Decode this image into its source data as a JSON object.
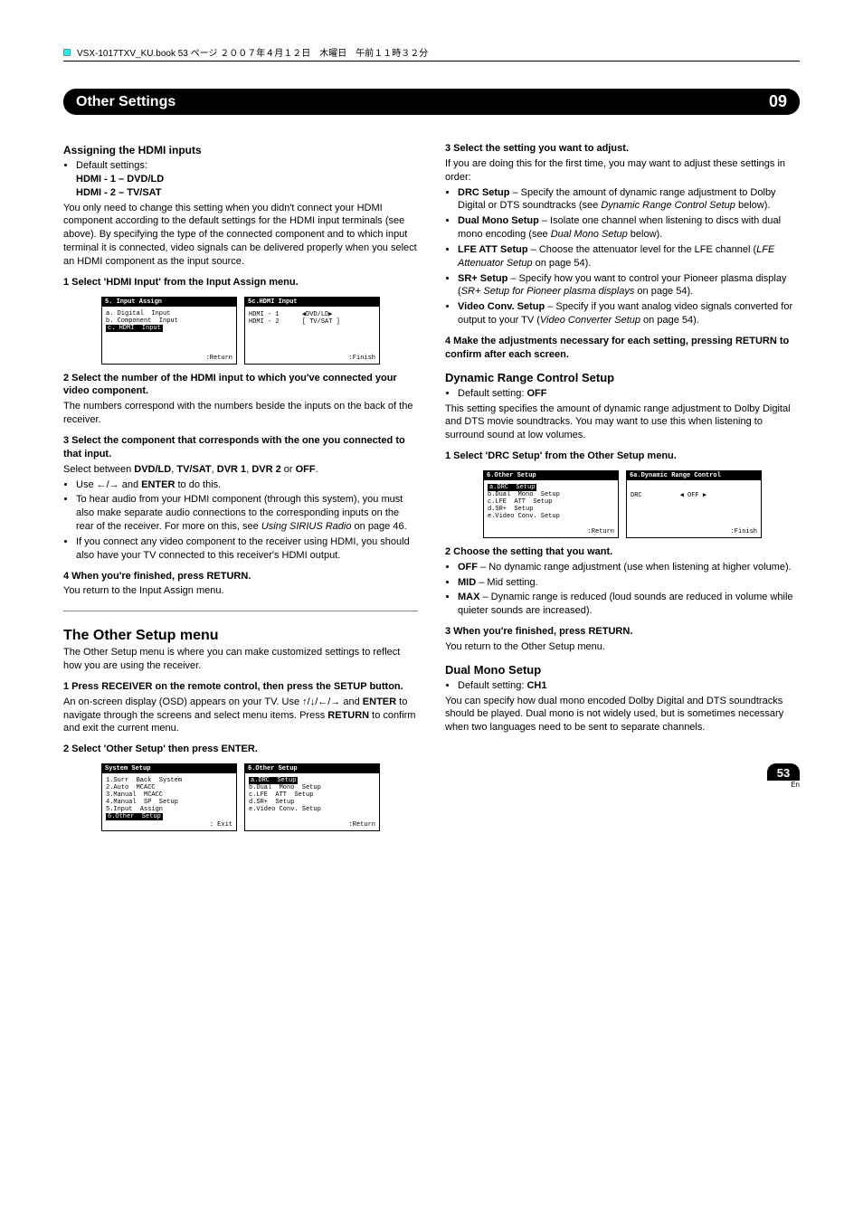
{
  "bookline": "VSX-1017TXV_KU.book  53 ページ  ２００７年４月１２日　木曜日　午前１１時３２分",
  "chapter": {
    "title": "Other Settings",
    "number": "09"
  },
  "left": {
    "h_assign": "Assigning the HDMI inputs",
    "default_label": "Default settings:",
    "hdmi1": "HDMI - 1 – DVD/LD",
    "hdmi2": "HDMI - 2 – TV/SAT",
    "assign_intro": "You only need to change this setting when you didn't connect your HDMI component according to the default settings for the HDMI input terminals (see above). By specifying the type of the connected component and to which input terminal it is connected, video signals can be delivered properly when you select an HDMI component as the input source.",
    "step1": "1   Select 'HDMI Input' from the Input Assign menu.",
    "box1a_title": "5. Input  Assign",
    "box1a_l1": "a. Digital  Input",
    "box1a_l2": "b. Component  Input",
    "box1a_l3": "c. HDMI  Input",
    "box1a_foot": ":Return",
    "box1b_title": "5c.HDMI  Input",
    "box1b_l1": "HDMI - 1      ◀DVD/LD▶",
    "box1b_l2": "HDMI - 2      [ TV/SAT ]",
    "box1b_foot": ":Finish",
    "step2": "2   Select the number of the HDMI input to which you've connected your video component.",
    "step2_body": "The numbers correspond with the numbers beside the inputs on the back of the receiver.",
    "step3": "3   Select the component that corresponds with the one you connected to that input.",
    "step3_body": "Select between DVD/LD, TV/SAT, DVR 1, DVR 2 or OFF.",
    "b1": "Use ←/→ and ENTER to do this.",
    "b2": "To hear audio from your HDMI component (through this system), you must also make separate audio connections to the corresponding inputs on the rear of the receiver. For more on this, see Using SIRIUS Radio on page 46.",
    "b3": "If you connect any video component to the receiver using HDMI, you should also have your TV connected to this receiver's HDMI output.",
    "step4": "4   When you're finished, press RETURN.",
    "step4_body": "You return to the Input Assign menu.",
    "h_other": "The Other Setup menu",
    "other_intro": "The Other Setup menu is where you can make customized settings to reflect how you are using the receiver.",
    "ostep1": "1   Press RECEIVER on the remote control, then press the SETUP button.",
    "ostep1_body": "An on-screen display (OSD) appears on your TV. Use ↑/↓/←/→ and ENTER to navigate through the screens and select menu items. Press RETURN to confirm and exit the current menu.",
    "ostep2": "2   Select 'Other Setup' then press ENTER.",
    "box2a_title": "System  Setup",
    "box2a_l1": "1.Surr  Back  System",
    "box2a_l2": "2.Auto  MCACC",
    "box2a_l3": "3.Manual  MCACC",
    "box2a_l4": "4.Manual  SP  Setup",
    "box2a_l5": "5.Input  Assign",
    "box2a_l6": "6.Other  Setup",
    "box2a_foot": " : Exit",
    "box2b_title": "6.Other  Setup",
    "box2b_l1": "a.DRC  Setup",
    "box2b_l2": "b.Dual  Mono  Setup",
    "box2b_l3": "c.LFE  ATT  Setup",
    "box2b_l4": "d.SR+  Setup",
    "box2b_l5": "e.Video Conv. Setup",
    "box2b_foot": ":Return"
  },
  "right": {
    "step3": "3   Select the setting you want to adjust.",
    "step3_body": "If you are doing this for the first time, you may want to adjust these settings in order:",
    "b_drc": "DRC Setup – Specify the amount of dynamic range adjustment to Dolby Digital or DTS soundtracks (see Dynamic Range Control Setup below).",
    "b_dual": "Dual Mono Setup – Isolate one channel when listening to discs with dual mono encoding (see Dual Mono Setup below).",
    "b_lfe": "LFE ATT Setup – Choose the attenuator level for the LFE channel (LFE Attenuator Setup on page 54).",
    "b_sr": "SR+ Setup – Specify how you want to control your Pioneer plasma display (SR+ Setup for Pioneer plasma displays on page 54).",
    "b_vc": "Video Conv. Setup – Specify if you want analog video signals converted for output to your TV (Video Converter Setup on page 54).",
    "step4": "4   Make the adjustments necessary for each setting, pressing RETURN to confirm after each screen.",
    "h_drc": "Dynamic Range Control Setup",
    "drc_def": "Default setting: OFF",
    "drc_intro": "This setting specifies the amount of dynamic range adjustment to Dolby Digital and DTS movie soundtracks. You may want to use this when listening to surround sound at low volumes.",
    "drc_step1": "1   Select 'DRC Setup' from the Other Setup menu.",
    "box3a_title": "6.Other  Setup",
    "box3a_l1": "a.DRC  Setup",
    "box3a_l2": "b.Dual  Mono  Setup",
    "box3a_l3": "c.LFE  ATT  Setup",
    "box3a_l4": "d.SR+  Setup",
    "box3a_l5": "e.Video Conv. Setup",
    "box3a_foot": ":Return",
    "box3b_title": "6a.Dynamic  Range  Control",
    "box3b_l1": "DRC          ◀ OFF ▶",
    "box3b_foot": ":Finish",
    "drc_step2": "2   Choose the setting that you want.",
    "drc_off": "OFF – No dynamic range adjustment (use when listening at higher volume).",
    "drc_mid": "MID – Mid setting.",
    "drc_max": "MAX – Dynamic range is reduced (loud sounds are reduced in volume while quieter sounds are increased).",
    "drc_step3": "3   When you're finished, press RETURN.",
    "drc_step3_body": "You return to the Other Setup menu.",
    "h_dual": "Dual Mono Setup",
    "dual_def": "Default setting: CH1",
    "dual_intro": "You can specify how dual mono encoded Dolby Digital and DTS soundtracks should be played. Dual mono is not widely used, but is sometimes necessary when two languages need to be sent to separate channels."
  },
  "page_number": "53",
  "page_lang": "En"
}
